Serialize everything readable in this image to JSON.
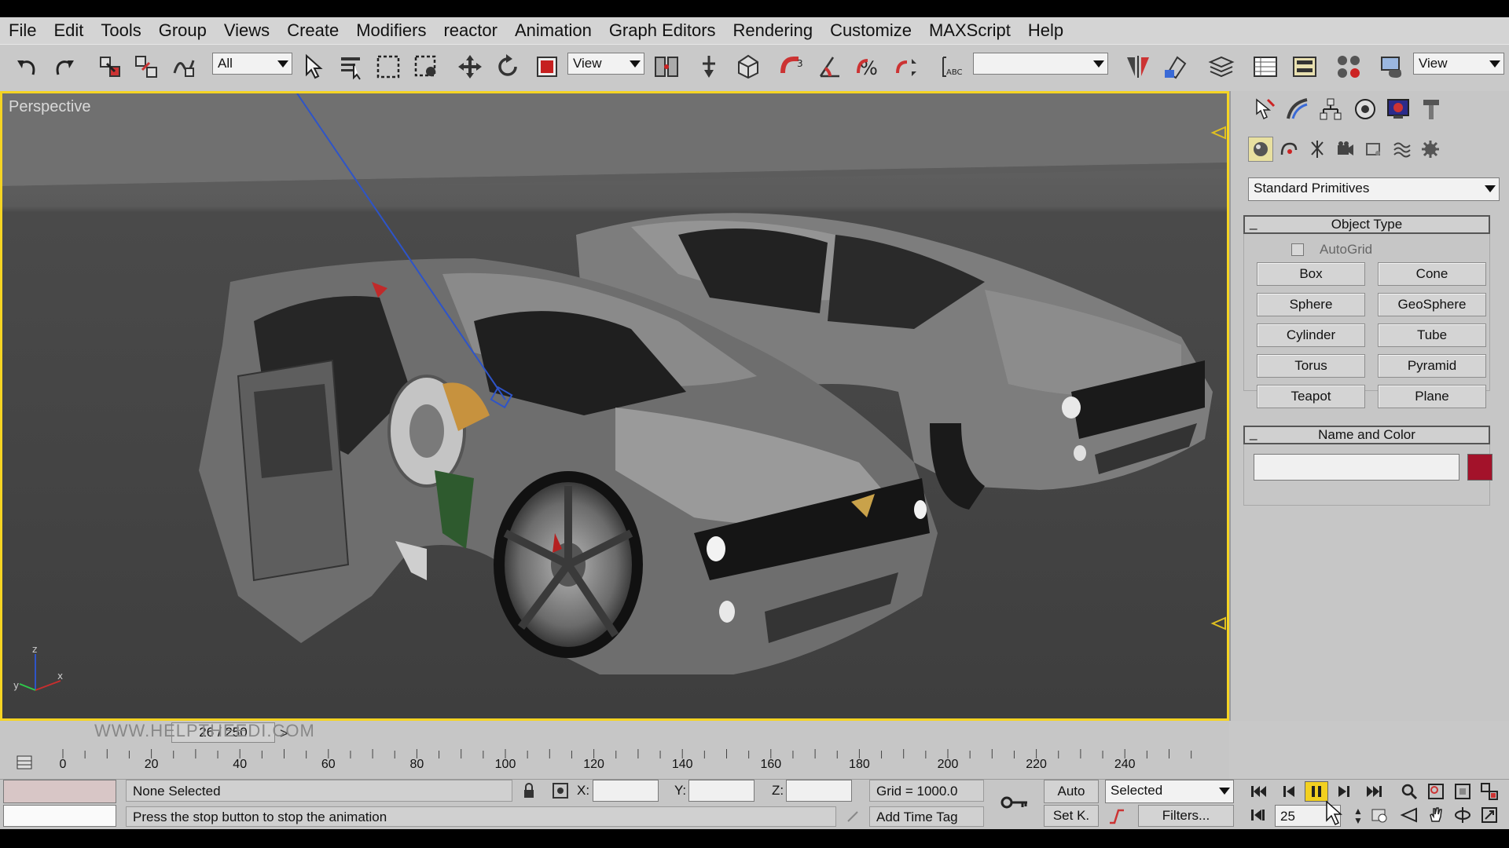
{
  "menu": [
    "File",
    "Edit",
    "Tools",
    "Group",
    "Views",
    "Create",
    "Modifiers",
    "reactor",
    "Animation",
    "Graph Editors",
    "Rendering",
    "Customize",
    "MAXScript",
    "Help"
  ],
  "toolbar": {
    "selection_filter": "All",
    "ref_coord": "View",
    "named_selection": "",
    "render_view": "View"
  },
  "viewport": {
    "label": "Perspective"
  },
  "command_panel": {
    "category": "Standard Primitives",
    "object_type_title": "Object Type",
    "autogrid_label": "AutoGrid",
    "autogrid_checked": false,
    "buttons": [
      "Box",
      "Cone",
      "Sphere",
      "GeoSphere",
      "Cylinder",
      "Tube",
      "Torus",
      "Pyramid",
      "Teapot",
      "Plane"
    ],
    "name_color_title": "Name and Color",
    "object_name": "",
    "object_color": "#a3122a"
  },
  "timeline": {
    "frame_readout": "26 / 250",
    "ticks": [
      "0",
      "20",
      "40",
      "60",
      "80",
      "100",
      "120",
      "140",
      "160",
      "180",
      "200",
      "220",
      "240"
    ]
  },
  "status": {
    "selection": "None Selected",
    "prompt": "Press the stop button to stop the animation",
    "x_label": "X:",
    "y_label": "Y:",
    "z_label": "Z:",
    "x_value": "",
    "y_value": "",
    "z_value": "",
    "grid": "Grid = 1000.0",
    "add_time_tag": "Add Time Tag",
    "auto_key": "Auto",
    "set_key": "Set K.",
    "key_filter": "Selected",
    "filters": "Filters...",
    "current_frame": "25"
  },
  "watermark": "WWW.HELPTHEEDI.COM",
  "colors": {
    "viewport_border": "#f5d423",
    "viewport_bg": "#454545"
  }
}
